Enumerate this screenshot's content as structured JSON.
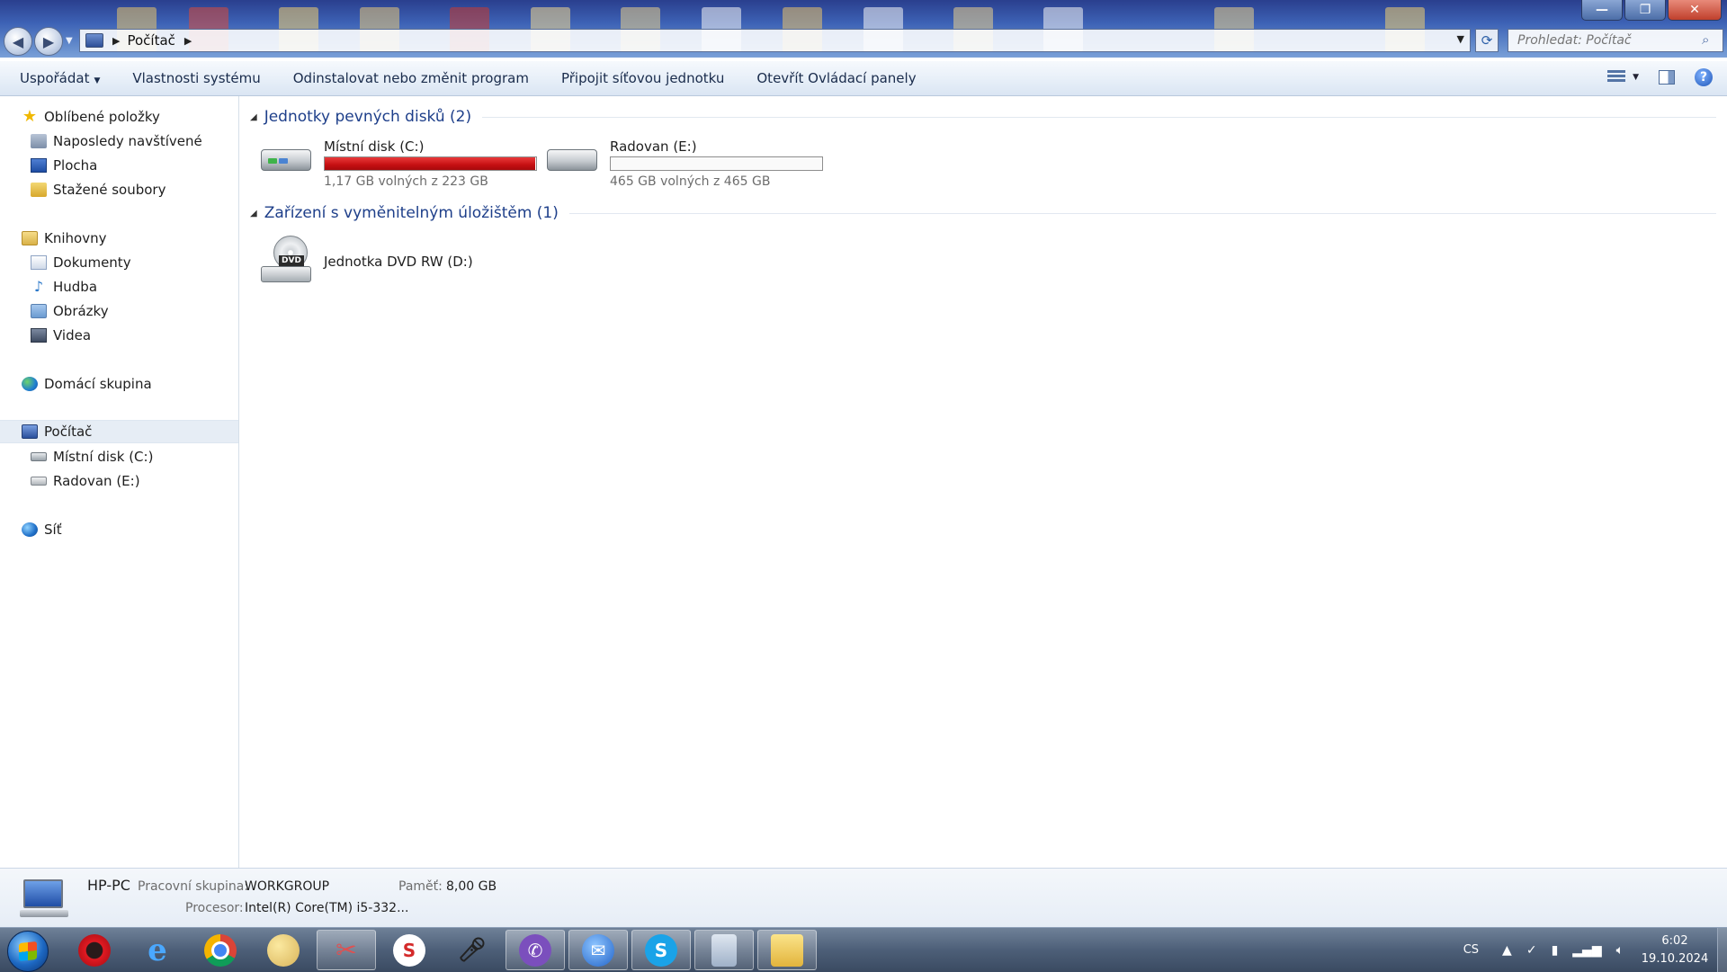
{
  "window": {
    "buttons": {
      "minimize": "—",
      "maximize": "❐",
      "close": "✕"
    }
  },
  "address": {
    "crumb": "Počítač",
    "separator": "▶"
  },
  "search": {
    "placeholder": "Prohledat: Počítač"
  },
  "commands": {
    "organize": "Uspořádat",
    "system_properties": "Vlastnosti systému",
    "uninstall": "Odinstalovat nebo změnit program",
    "map_drive": "Připojit síťovou jednotku",
    "control_panel": "Otevřít Ovládací panely"
  },
  "nav": {
    "favorites": "Oblíbené položky",
    "recent": "Naposledy navštívené",
    "desktop": "Plocha",
    "downloads": "Stažené soubory",
    "libraries": "Knihovny",
    "documents": "Dokumenty",
    "music": "Hudba",
    "pictures": "Obrázky",
    "videos": "Videa",
    "homegroup": "Domácí skupina",
    "computer": "Počítač",
    "drive_c": "Místní disk (C:)",
    "drive_e": "Radovan (E:)",
    "network": "Síť"
  },
  "content": {
    "hdd_section": "Jednotky pevných disků (2)",
    "removable_section": "Zařízení s vyměnitelným úložištěm (1)",
    "drives": [
      {
        "name": "Místní disk (C:)",
        "free_text": "1,17 GB volných z 223 GB",
        "used_fraction": 0.995,
        "status_color": "#c50f12"
      },
      {
        "name": "Radovan (E:)",
        "free_text": "465 GB volných z 465 GB",
        "used_fraction": 0.0,
        "status_color": "#267fcf"
      }
    ],
    "dvd": {
      "name": "Jednotka DVD RW (D:)",
      "label": "DVD"
    }
  },
  "details": {
    "pc_name": "HP-PC",
    "workgroup_label": "Pracovní skupina:",
    "workgroup_value": "WORKGROUP",
    "memory_label": "Paměť:",
    "memory_value": "8,00 GB",
    "cpu_label": "Procesor:",
    "cpu_value": "Intel(R) Core(TM) i5-332..."
  },
  "taskbar": {
    "apps": [
      "opera-icon",
      "ie-icon",
      "chrome-icon",
      "paint-icon",
      "snipping-icon",
      "s-app-icon",
      "microphone-icon",
      "viber-icon",
      "thunderbird-icon",
      "skype-icon",
      "calculator-icon",
      "explorer-icon"
    ],
    "language": "CS",
    "time": "6:02",
    "date": "19.10.2024"
  },
  "colors": {
    "accent": "#1e3f8a",
    "drive_full": "#c50f12",
    "drive_ok": "#267fcf"
  }
}
